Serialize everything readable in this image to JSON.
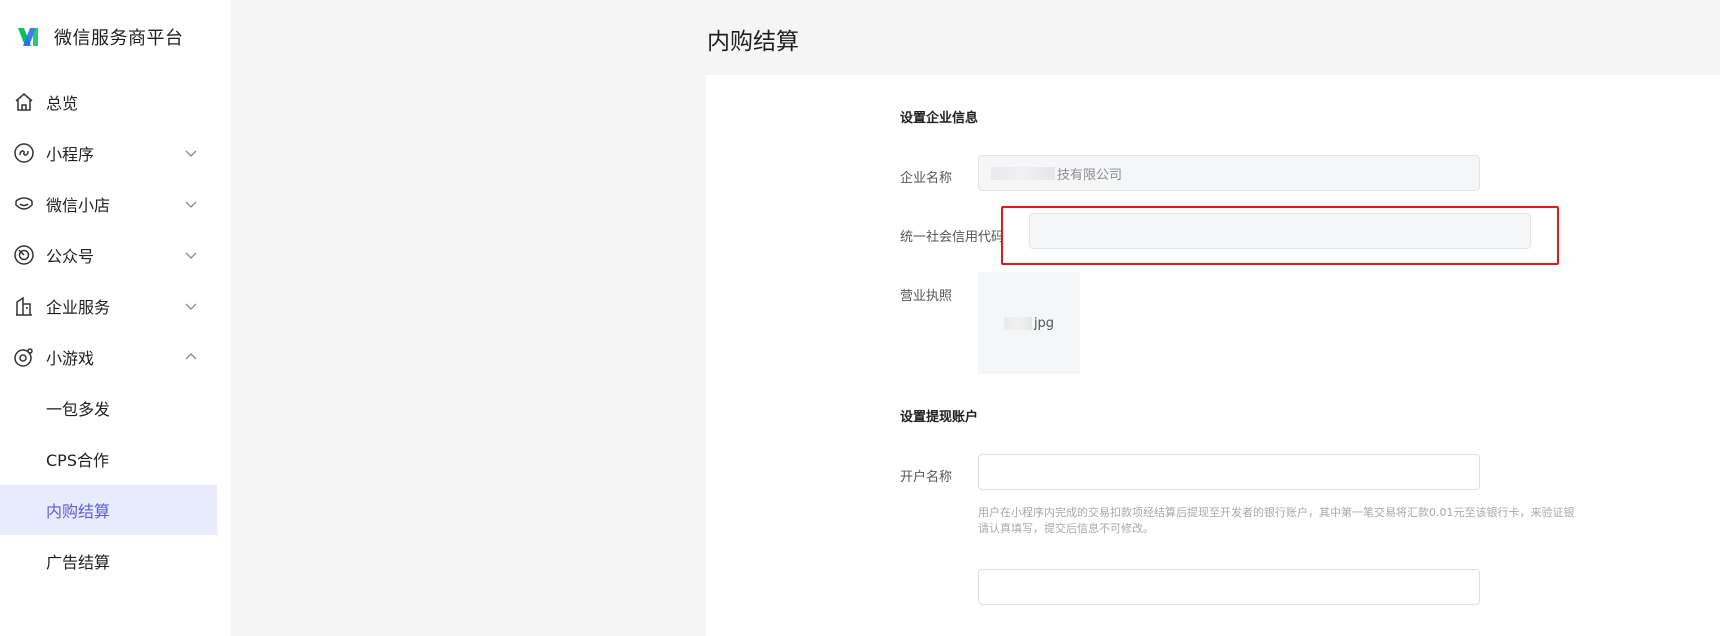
{
  "sidebar": {
    "brand": {
      "name": "微信服务商平台",
      "logo_icon": "wechat-service-logo-icon"
    },
    "items": [
      {
        "label": "总览",
        "icon": "home-icon",
        "chevron": ""
      },
      {
        "label": "小程序",
        "icon": "mini-program-icon",
        "chevron": "down"
      },
      {
        "label": "微信小店",
        "icon": "shop-icon",
        "chevron": "down"
      },
      {
        "label": "公众号",
        "icon": "official-account-icon",
        "chevron": "down"
      },
      {
        "label": "企业服务",
        "icon": "enterprise-icon",
        "chevron": "down"
      },
      {
        "label": "小游戏",
        "icon": "mini-game-icon",
        "chevron": "up"
      }
    ],
    "sub_items": [
      {
        "label": "一包多发",
        "active": false
      },
      {
        "label": "CPS合作",
        "active": false
      },
      {
        "label": "内购结算",
        "active": true
      },
      {
        "label": "广告结算",
        "active": false
      }
    ]
  },
  "main": {
    "title": "内购结算",
    "company_section": {
      "title": "设置企业信息",
      "company_name_label": "企业名称",
      "company_name_value": "技有限公司",
      "credit_code_label": "统一社会信用代码",
      "credit_code_value": "",
      "license_label": "营业执照",
      "license_file": "jpg"
    },
    "withdraw_section": {
      "title": "设置提现账户",
      "account_name_label": "开户名称",
      "account_name_value": "",
      "hint_line1": "用户在小程序内完成的交易扣款项经结算后提现至开发者的银行账户，其中第一笔交易将汇款0.01元至该银行卡，来验证银",
      "hint_line2": "请认真填写，提交后信息不可修改。"
    }
  },
  "colors": {
    "accent": "#5b5fd6",
    "active_bg": "#e8ebfb",
    "highlight": "#e01b1b",
    "logo_green": "#07c160",
    "logo_blue": "#2b6cf6"
  }
}
